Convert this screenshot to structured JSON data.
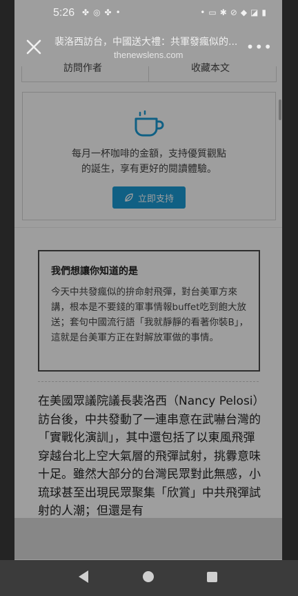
{
  "status_bar": {
    "time": "5:26",
    "left_icons": [
      "android-icon",
      "sync-icon",
      "android-icon",
      "dot-icon"
    ],
    "right_icons": [
      "dot-icon",
      "battery-saver-icon",
      "bluetooth-icon",
      "mute-icon",
      "wifi-icon",
      "no-sim-icon",
      "battery-icon"
    ]
  },
  "browser": {
    "page_title": "裴洛西訪台，中國送大禮：共軍發瘋似的...",
    "url": "thenewslens.com",
    "more_label": "•••"
  },
  "tabs": {
    "left_label": "訪問作者",
    "right_label": "收藏本文"
  },
  "support": {
    "line1": "每月一杯咖啡的金額，支持優質觀點",
    "line2": "的誕生，享有更好的閱讀體驗。",
    "button_label": "立即支持",
    "accent_color": "#1a9bd5"
  },
  "insight": {
    "heading": "我們想讓你知道的是",
    "text": "今天中共發瘋似的拚命射飛彈，對台美軍方來講，根本是不要錢的軍事情報buffet吃到飽大放送；套句中國流行語「我就靜靜的看著你裝B」，這就是台美軍方正在對解放軍做的事情。"
  },
  "article": {
    "paragraph": "在美國眾議院議長裴洛西（Nancy Pelosi）訪台後，中共發動了一連串意在武嚇台灣的「實戰化演訓」，其中還包括了以東風飛彈穿越台北上空大氣層的飛彈試射，挑釁意味十足。雖然大部分的台灣民眾對此無感，小琉球甚至出現民眾聚集「欣賞」中共飛彈試射的人潮；但還是有"
  }
}
